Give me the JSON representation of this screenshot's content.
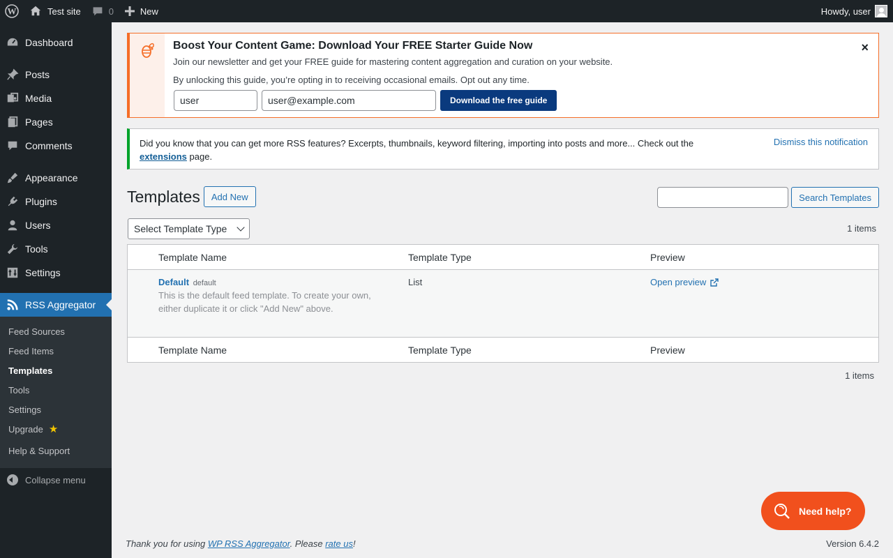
{
  "adminbar": {
    "site_name": "Test site",
    "comments_count": "0",
    "new_label": "New",
    "howdy": "Howdy, user"
  },
  "sidebar": {
    "items": [
      {
        "label": "Dashboard",
        "icon": "dashboard-icon"
      },
      {
        "label": "Posts",
        "icon": "pin-icon"
      },
      {
        "label": "Media",
        "icon": "media-icon"
      },
      {
        "label": "Pages",
        "icon": "pages-icon"
      },
      {
        "label": "Comments",
        "icon": "comment-icon"
      },
      {
        "label": "Appearance",
        "icon": "brush-icon"
      },
      {
        "label": "Plugins",
        "icon": "plugin-icon"
      },
      {
        "label": "Users",
        "icon": "user-icon"
      },
      {
        "label": "Tools",
        "icon": "wrench-icon"
      },
      {
        "label": "Settings",
        "icon": "settings-icon"
      },
      {
        "label": "RSS Aggregator",
        "icon": "rss-icon"
      }
    ],
    "submenu": [
      "Feed Sources",
      "Feed Items",
      "Templates",
      "Tools",
      "Settings",
      "Upgrade",
      "Help & Support"
    ],
    "collapse": "Collapse menu"
  },
  "promo": {
    "title": "Boost Your Content Game: Download Your FREE Starter Guide Now",
    "line1": "Join our newsletter and get your FREE guide for mastering content aggregation and curation on your website.",
    "line2": "By unlocking this guide, you’re opting in to receiving occasional emails. Opt out any time.",
    "name_value": "user",
    "email_value": "user@example.com",
    "button": "Download the free guide",
    "close": "×"
  },
  "notice": {
    "text_before": "Did you know that you can get more RSS features? Excerpts, thumbnails, keyword filtering, importing into posts and more... Check out the",
    "link": "extensions",
    "text_after": "page.",
    "dismiss": "Dismiss this notification"
  },
  "page": {
    "title": "Templates",
    "add_new": "Add New",
    "search_button": "Search Templates",
    "filter_selected": "Select Template Type",
    "count": "1 items"
  },
  "table": {
    "columns": [
      "Template Name",
      "Template Type",
      "Preview"
    ],
    "rows": [
      {
        "name": "Default",
        "slug": "default",
        "description": "This is the default feed template. To create your own, either duplicate it or click \"Add New\" above.",
        "type": "List",
        "preview": "Open preview"
      }
    ]
  },
  "help": {
    "label": "Need help?"
  },
  "footer": {
    "thanks_before": "Thank you for using",
    "plugin_link": "WP RSS Aggregator",
    "thanks_mid": ". Please",
    "rate_link": "rate us",
    "thanks_after": "!",
    "version": "Version 6.4.2"
  },
  "colors": {
    "admin_dark": "#1d2327",
    "accent": "#2271b1",
    "promo_orange": "#f56e28",
    "success_green": "#00a32a",
    "help_orange": "#f1501d"
  }
}
